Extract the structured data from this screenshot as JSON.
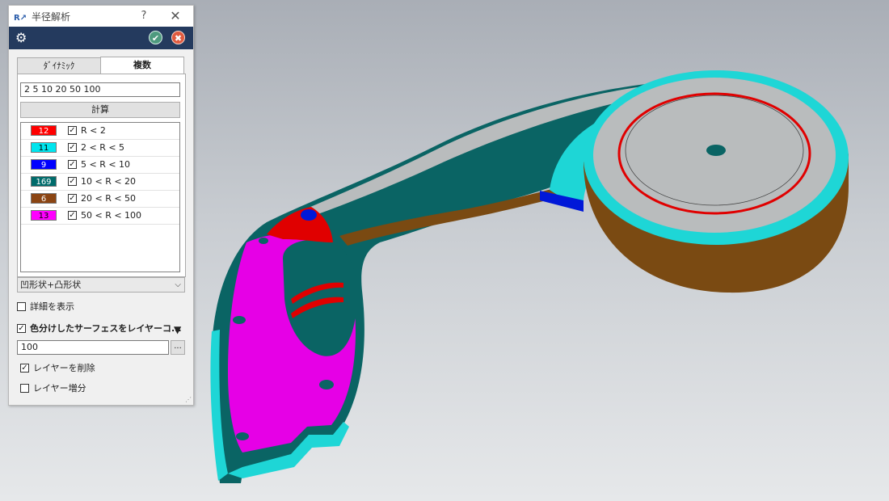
{
  "window": {
    "title": "半径解析",
    "help_glyph": "?",
    "close_glyph": "✕"
  },
  "tabs": [
    {
      "label": "ﾀﾞｲﾅﾐｯｸ"
    },
    {
      "label": "複数"
    }
  ],
  "radius_values": "2  5  10  20  50  100",
  "calc_button": "計算",
  "legend": [
    {
      "count": "12",
      "color": "#ff0000",
      "text_color": "#ffffff",
      "range": "R < 2",
      "checked": true
    },
    {
      "count": "11",
      "color": "#00e5ee",
      "text_color": "#000000",
      "range": "2 < R < 5",
      "checked": true
    },
    {
      "count": "9",
      "color": "#0000ff",
      "text_color": "#ffffff",
      "range": "5 < R < 10",
      "checked": true
    },
    {
      "count": "169",
      "color": "#006b6b",
      "text_color": "#ffffff",
      "range": "10 < R < 20",
      "checked": true
    },
    {
      "count": "6",
      "color": "#8b4513",
      "text_color": "#ffffff",
      "range": "20 < R < 50",
      "checked": true
    },
    {
      "count": "13",
      "color": "#ff00ff",
      "text_color": "#000000",
      "range": "50 < R < 100",
      "checked": true
    }
  ],
  "shape_select": "凹形状+凸形状",
  "show_details": {
    "label": "詳細を表示",
    "checked": false
  },
  "color_surface_layer": {
    "label": "色分けしたサーフェスをレイヤーコ...",
    "checked": true
  },
  "layer_number": "100",
  "browse_label": "...",
  "delete_layer": {
    "label": "レイヤーを削除",
    "checked": true
  },
  "layer_increment": {
    "label": "レイヤー増分",
    "checked": false
  },
  "colors": {
    "header_bar": "#243a5e",
    "ok": "#4e9a7f",
    "cancel": "#e05a3f",
    "model_teal": "#0a6464",
    "model_cyan": "#1ed6d6",
    "model_gray": "#b9bcbd",
    "model_brown": "#7a4a12",
    "model_magenta": "#e600e6",
    "model_red": "#e00000",
    "model_blue": "#0018d8"
  }
}
